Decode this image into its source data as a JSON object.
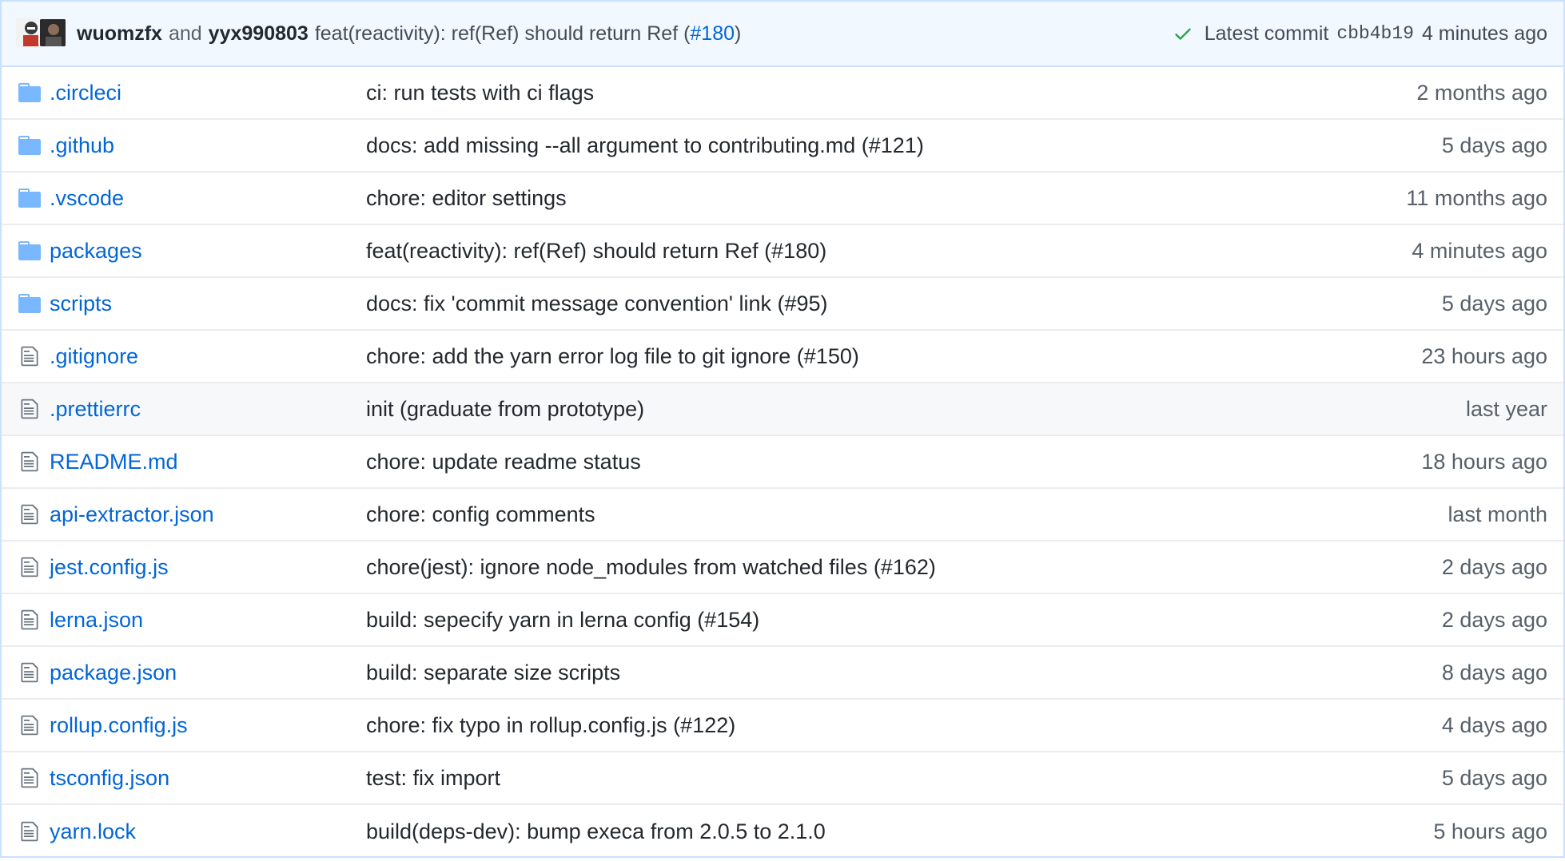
{
  "header": {
    "author1": "wuomzfx",
    "and_text": "and",
    "author2": "yyx990803",
    "message_prefix": "feat(reactivity): ref(Ref) should return Ref (",
    "issue": "#180",
    "message_suffix": ")",
    "latest_label": "Latest commit",
    "sha": "cbb4b19",
    "age": "4 minutes ago"
  },
  "colors": {
    "link": "#0366d6",
    "folder": "#79b8ff",
    "header_bg": "#f1f8ff",
    "check": "#28a745"
  },
  "files": [
    {
      "type": "folder",
      "icon": "folder-icon",
      "name": ".circleci",
      "commit": "ci: run tests with ci flags",
      "age": "2 months ago"
    },
    {
      "type": "folder",
      "icon": "folder-icon",
      "name": ".github",
      "commit": "docs: add missing --all argument to contributing.md (#121)",
      "age": "5 days ago"
    },
    {
      "type": "folder",
      "icon": "folder-icon",
      "name": ".vscode",
      "commit": "chore: editor settings",
      "age": "11 months ago"
    },
    {
      "type": "folder",
      "icon": "folder-icon",
      "name": "packages",
      "commit": "feat(reactivity): ref(Ref) should return Ref (#180)",
      "age": "4 minutes ago"
    },
    {
      "type": "folder",
      "icon": "folder-icon",
      "name": "scripts",
      "commit": "docs: fix 'commit message convention' link (#95)",
      "age": "5 days ago"
    },
    {
      "type": "file",
      "icon": "file-icon",
      "name": ".gitignore",
      "commit": "chore: add the yarn error log file to git ignore (#150)",
      "age": "23 hours ago"
    },
    {
      "type": "file",
      "icon": "file-icon",
      "name": ".prettierrc",
      "commit": "init (graduate from prototype)",
      "age": "last year",
      "highlight": true
    },
    {
      "type": "file",
      "icon": "file-icon",
      "name": "README.md",
      "commit": "chore: update readme status",
      "age": "18 hours ago"
    },
    {
      "type": "file",
      "icon": "file-icon",
      "name": "api-extractor.json",
      "commit": "chore: config comments",
      "age": "last month"
    },
    {
      "type": "file",
      "icon": "file-icon",
      "name": "jest.config.js",
      "commit": "chore(jest): ignore node_modules from watched files (#162)",
      "age": "2 days ago"
    },
    {
      "type": "file",
      "icon": "file-icon",
      "name": "lerna.json",
      "commit": "build: sepecify yarn in lerna config (#154)",
      "age": "2 days ago"
    },
    {
      "type": "file",
      "icon": "file-icon",
      "name": "package.json",
      "commit": "build: separate size scripts",
      "age": "8 days ago"
    },
    {
      "type": "file",
      "icon": "file-icon",
      "name": "rollup.config.js",
      "commit": "chore: fix typo in rollup.config.js (#122)",
      "age": "4 days ago"
    },
    {
      "type": "file",
      "icon": "file-icon",
      "name": "tsconfig.json",
      "commit": "test: fix import",
      "age": "5 days ago"
    },
    {
      "type": "file",
      "icon": "file-icon",
      "name": "yarn.lock",
      "commit": "build(deps-dev): bump execa from 2.0.5 to 2.1.0",
      "age": "5 hours ago"
    }
  ]
}
